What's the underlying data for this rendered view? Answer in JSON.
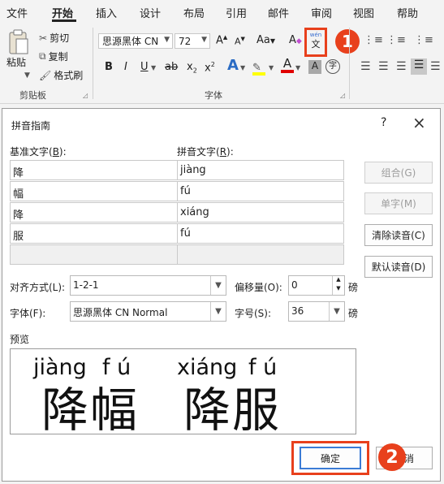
{
  "ribbon": {
    "tabs": [
      "文件",
      "开始",
      "插入",
      "设计",
      "布局",
      "引用",
      "邮件",
      "审阅",
      "视图",
      "帮助"
    ],
    "clipboard": {
      "paste": "粘贴",
      "cut": "剪切",
      "copy": "复制",
      "format_painter": "格式刷",
      "group_label": "剪贴板"
    },
    "font": {
      "font_name": "思源黑体 CN",
      "font_size": "72",
      "grow": "A",
      "shrink": "A",
      "change_case": "Aa",
      "clear": "A",
      "phonetic_top": "wén",
      "phonetic_bottom": "文",
      "bold": "B",
      "italic": "I",
      "underline": "U",
      "strike": "ab",
      "subscript": "x",
      "superscript": "x",
      "sub_mark": "2",
      "sup_mark": "2",
      "effects": "A",
      "font_color": "A",
      "char_shading": "A",
      "enclose": "字",
      "group_label": "字体"
    },
    "annotations": {
      "badge1": "1",
      "badge2": "2"
    },
    "colors": {
      "accent_red": "#e8401c",
      "highlight_yellow": "#ffff00",
      "font_red": "#e00000"
    }
  },
  "dialog": {
    "title": "拼音指南",
    "help": "?",
    "close": "×",
    "base_label": "基准文字(",
    "base_key": "B",
    "base_tail": "):",
    "ruby_label": "拼音文字(",
    "ruby_key": "R",
    "ruby_tail": "):",
    "rows": [
      {
        "base": "降",
        "ruby": "jiàng"
      },
      {
        "base": "幅",
        "ruby": "fú"
      },
      {
        "base": "降",
        "ruby": "xiáng"
      },
      {
        "base": "服",
        "ruby": "fú"
      },
      {
        "base": "",
        "ruby": ""
      }
    ],
    "buttons": {
      "group": "组合(G)",
      "mono": "单字(M)",
      "clear": "清除读音(C)",
      "default": "默认读音(D)",
      "ok": "确定",
      "cancel": "取消"
    },
    "alignment_label": "对齐方式(L):",
    "alignment_value": "1-2-1",
    "offset_label": "偏移量(O):",
    "offset_value": "0",
    "offset_unit": "磅",
    "font_label": "字体(F):",
    "font_value": "思源黑体 CN Normal",
    "size_label": "字号(S):",
    "size_value": "36",
    "size_unit": "磅",
    "preview_label": "预览",
    "preview": {
      "pinyin1": "jiàng",
      "pinyin2": "f ú",
      "pinyin3": "xiáng",
      "pinyin4": "f ú",
      "chars1": "降幅",
      "chars2": "降服"
    }
  }
}
